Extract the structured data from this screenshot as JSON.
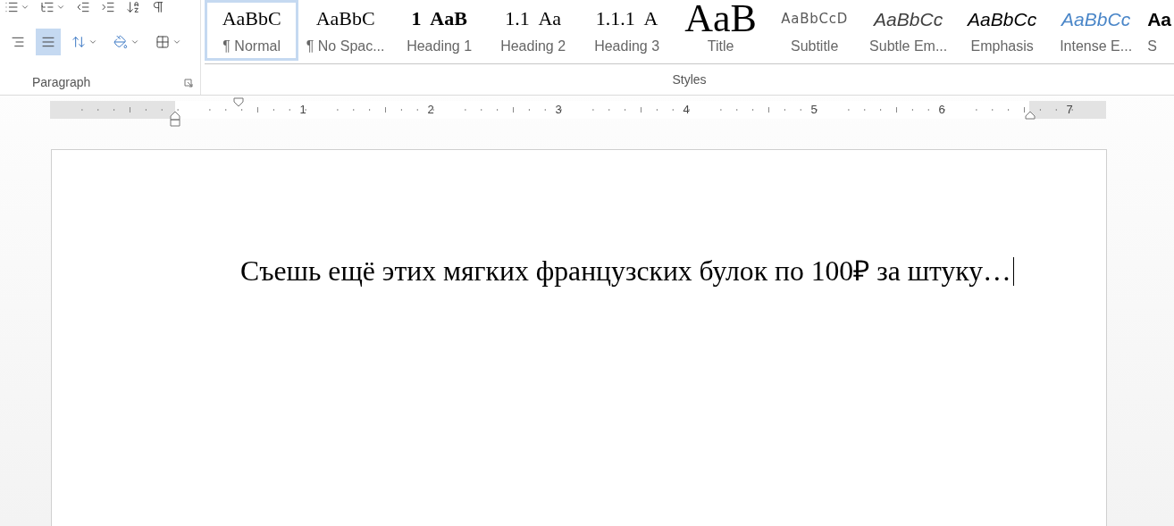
{
  "paragraph_group": {
    "label": "Paragraph",
    "top_row": [
      {
        "kind": "bullets"
      },
      {
        "kind": "multilevel"
      },
      {
        "kind": "outdent"
      },
      {
        "kind": "indent"
      },
      {
        "kind": "sort"
      },
      {
        "kind": "pilcrow"
      }
    ],
    "bottom_row": [
      {
        "kind": "align-right",
        "selected": false
      },
      {
        "kind": "justify",
        "selected": true
      },
      {
        "kind": "line-spacing",
        "selected": false
      },
      {
        "kind": "shading",
        "selected": false
      },
      {
        "kind": "borders",
        "selected": false
      }
    ]
  },
  "styles_group": {
    "label": "Styles",
    "items": [
      {
        "preview": "AaBbC",
        "label": "¶ Normal",
        "kind": "normal",
        "selected": true
      },
      {
        "preview": "AaBbC",
        "label": "¶ No Spac...",
        "kind": "normal",
        "selected": false
      },
      {
        "preview": "1  AaB",
        "label": "Heading 1",
        "kind": "heading1",
        "selected": false
      },
      {
        "preview": "1.1  Aa",
        "label": "Heading 2",
        "kind": "heading2",
        "selected": false
      },
      {
        "preview": "1.1.1  A",
        "label": "Heading 3",
        "kind": "heading3",
        "selected": false
      },
      {
        "preview": "AaB",
        "label": "Title",
        "kind": "title",
        "selected": false
      },
      {
        "preview": "AaBbCcD",
        "label": "Subtitle",
        "kind": "subtitle",
        "selected": false
      },
      {
        "preview": "AaBbCc",
        "label": "Subtle Em...",
        "kind": "subtle",
        "selected": false
      },
      {
        "preview": "AaBbCc",
        "label": "Emphasis",
        "kind": "emphasis",
        "selected": false
      },
      {
        "preview": "AaBbCc",
        "label": "Intense E...",
        "kind": "intense",
        "selected": false
      },
      {
        "preview": "Aa",
        "label": "S",
        "kind": "strong",
        "selected": false
      }
    ]
  },
  "ruler": {
    "numbers": [
      "1",
      "2",
      "3",
      "4",
      "5",
      "6",
      "7"
    ]
  },
  "document": {
    "text": "Съешь ещё этих мягких французских булок по 100₽ за штуку…"
  }
}
